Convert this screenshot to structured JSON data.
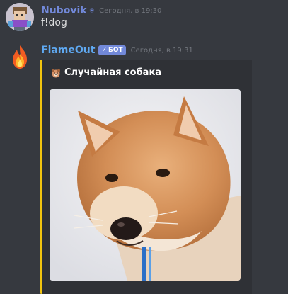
{
  "messages": [
    {
      "author": "Nubovik",
      "timestamp": "Сегодня, в 19:30",
      "text": "f!dog",
      "avatar_icon": "pixel-character-avatar-icon",
      "status_icon": "bot-status-icon"
    },
    {
      "author": "FlameOut",
      "badge": "БОТ",
      "timestamp": "Сегодня, в 19:31",
      "avatar_icon": "flame-icon",
      "embed": {
        "title": "Случайная собака",
        "title_icon": "dog-face-icon",
        "image_subject": "shiba-inu-dog-photo",
        "accent_color": "#f1c40f"
      }
    }
  ],
  "colors": {
    "background": "#36393f",
    "embed_background": "#2f3136",
    "author_user": "#7289da",
    "author_bot": "#5fa9f2",
    "text": "#dcddde",
    "timestamp": "#72767d",
    "bot_badge": "#7289da"
  }
}
